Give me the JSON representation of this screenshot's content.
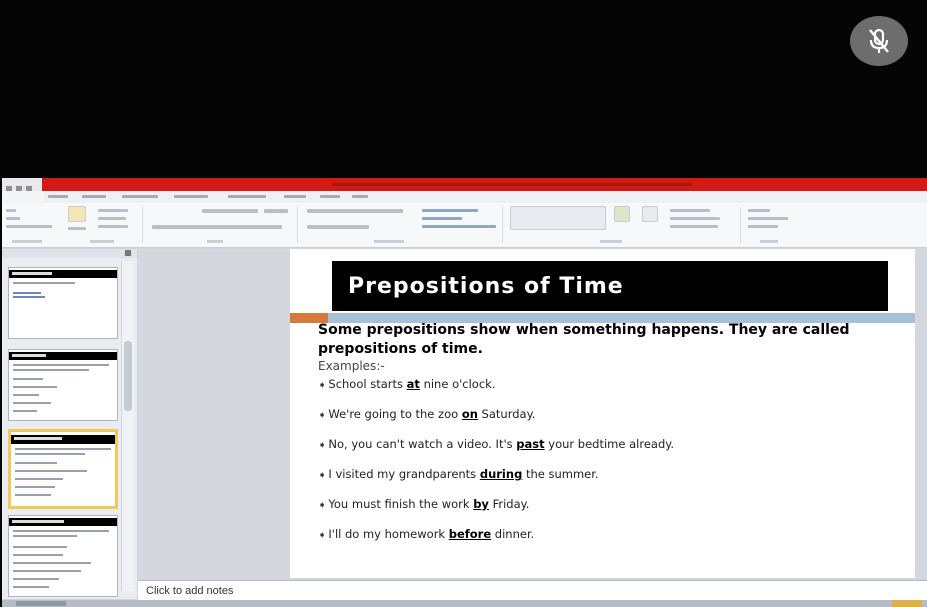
{
  "meeting": {
    "mute_icon": "microphone-slash-icon"
  },
  "slide": {
    "title": "Prepositions of Time",
    "intro": "Some prepositions show when something happens. They are called prepositions of time.",
    "examples_label": "Examples:-",
    "bullets": [
      {
        "before": "School starts ",
        "prep": "at",
        "after": " nine o'clock."
      },
      {
        "before": "We're going to the zoo ",
        "prep": "on",
        "after": " Saturday."
      },
      {
        "before": "No, you can't watch a video. It's ",
        "prep": "past",
        "after": " your bedtime already."
      },
      {
        "before": "I visited my grandparents ",
        "prep": "during",
        "after": " the summer."
      },
      {
        "before": "You must finish the work ",
        "prep": "by",
        "after": " Friday."
      },
      {
        "before": "I'll do my homework ",
        "prep": "before",
        "after": " dinner."
      }
    ]
  },
  "notes": {
    "placeholder": "Click to add notes"
  },
  "colors": {
    "title_bar": "#d41a12",
    "slide_title_bg": "#000000",
    "accent_orange": "#d6793b",
    "accent_blue": "#a8bfd9",
    "active_thumb_border": "#f1c85a"
  }
}
